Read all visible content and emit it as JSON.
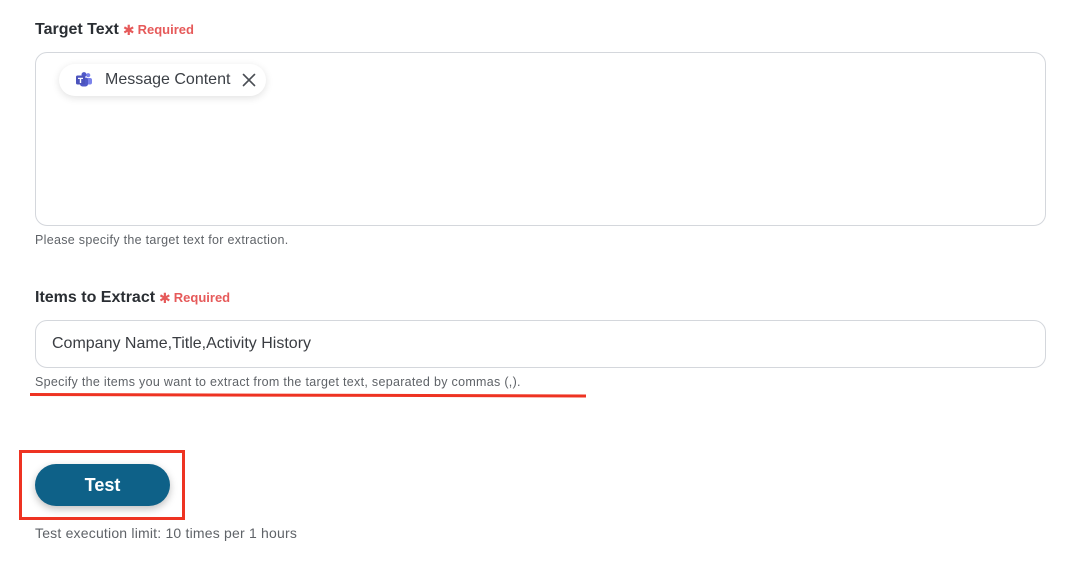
{
  "target_text": {
    "label": "Target Text",
    "required_label": "Required",
    "chip": {
      "icon": "microsoft-teams-icon",
      "label": "Message Content"
    },
    "help": "Please specify the target text for extraction."
  },
  "items_to_extract": {
    "label": "Items to Extract",
    "required_label": "Required",
    "value": "Company Name,Title,Activity History",
    "help": "Specify the items you want to extract from the target text, separated by commas (,)."
  },
  "test_button": {
    "label": "Test",
    "color": "#0e6188"
  },
  "limit_text": "Test execution limit: 10 times per 1 hours",
  "colors": {
    "required": "#e65a5a",
    "annotation": "#ee3322"
  }
}
